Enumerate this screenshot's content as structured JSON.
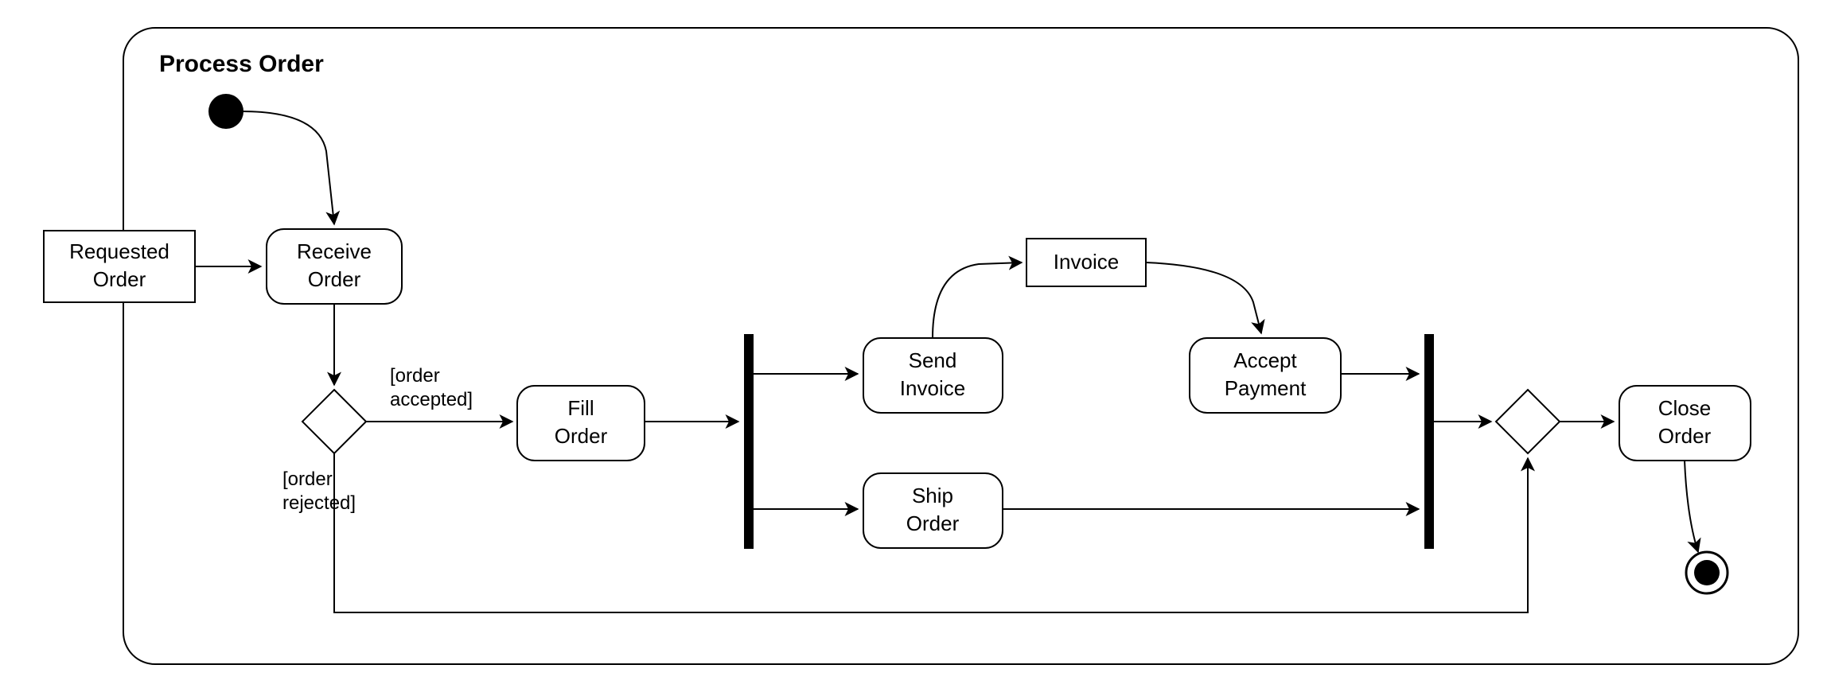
{
  "frame": {
    "title": "Process Order"
  },
  "nodes": {
    "requested_order": {
      "line1": "Requested",
      "line2": "Order"
    },
    "receive_order": {
      "line1": "Receive",
      "line2": "Order"
    },
    "fill_order": {
      "line1": "Fill",
      "line2": "Order"
    },
    "send_invoice": {
      "line1": "Send",
      "line2": "Invoice"
    },
    "invoice": {
      "line1": "Invoice"
    },
    "accept_payment": {
      "line1": "Accept",
      "line2": "Payment"
    },
    "ship_order": {
      "line1": "Ship",
      "line2": "Order"
    },
    "close_order": {
      "line1": "Close",
      "line2": "Order"
    }
  },
  "guards": {
    "accepted": {
      "line1": "[order",
      "line2": "accepted]"
    },
    "rejected": {
      "line1": "[order",
      "line2": "rejected]"
    }
  }
}
